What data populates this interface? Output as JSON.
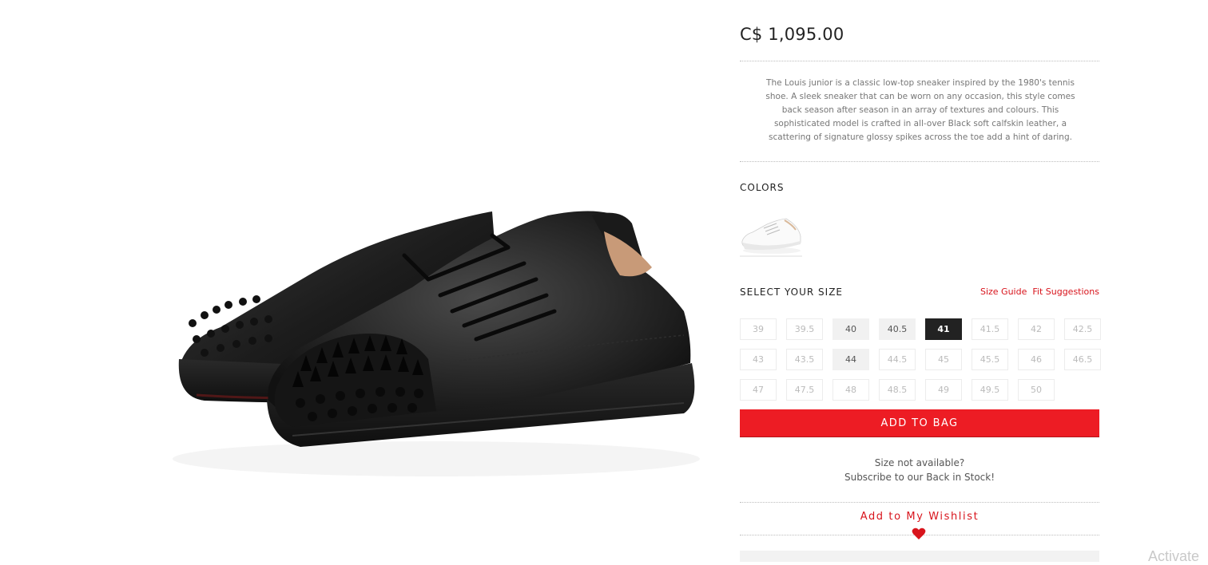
{
  "product": {
    "price": "C$ 1,095.00",
    "description": "The Louis junior is a classic low-top sneaker inspired by the 1980's tennis shoe. A sleek sneaker that can be worn on any occasion, this style comes back season after season in an array of textures and colours. This sophisticated model is crafted in all-over Black soft calfskin leather, a scattering of signature glossy spikes across the toe add a hint of daring."
  },
  "colors": {
    "label": "COLORS",
    "swatches": [
      {
        "name": "white-sneaker-swatch",
        "color": "#ffffff"
      }
    ]
  },
  "sizes": {
    "label": "SELECT YOUR SIZE",
    "size_guide": "Size Guide",
    "fit_suggestions": "Fit Suggestions",
    "selected": "41",
    "options": [
      {
        "value": "39",
        "status": "unavailable"
      },
      {
        "value": "39.5",
        "status": "unavailable"
      },
      {
        "value": "40",
        "status": "available"
      },
      {
        "value": "40.5",
        "status": "available"
      },
      {
        "value": "41",
        "status": "selected"
      },
      {
        "value": "41.5",
        "status": "unavailable"
      },
      {
        "value": "42",
        "status": "unavailable"
      },
      {
        "value": "42.5",
        "status": "unavailable"
      },
      {
        "value": "43",
        "status": "unavailable"
      },
      {
        "value": "43.5",
        "status": "unavailable"
      },
      {
        "value": "44",
        "status": "available"
      },
      {
        "value": "44.5",
        "status": "unavailable"
      },
      {
        "value": "45",
        "status": "unavailable"
      },
      {
        "value": "45.5",
        "status": "unavailable"
      },
      {
        "value": "46",
        "status": "unavailable"
      },
      {
        "value": "46.5",
        "status": "unavailable"
      },
      {
        "value": "47",
        "status": "unavailable"
      },
      {
        "value": "47.5",
        "status": "unavailable"
      },
      {
        "value": "48",
        "status": "unavailable"
      },
      {
        "value": "48.5",
        "status": "unavailable"
      },
      {
        "value": "49",
        "status": "unavailable"
      },
      {
        "value": "49.5",
        "status": "unavailable"
      },
      {
        "value": "50",
        "status": "unavailable"
      }
    ]
  },
  "actions": {
    "add_to_bag": "ADD TO BAG",
    "size_not_available": "Size not available?",
    "subscribe": "Subscribe to our Back in Stock!",
    "wishlist": "Add to My Wishlist"
  },
  "icons": {
    "wishlist": "heart-icon"
  },
  "theme": {
    "accent": "#ed1c24",
    "selected_bg": "#222222",
    "available_bg": "#f1f1f1"
  },
  "watermark": "Activate"
}
